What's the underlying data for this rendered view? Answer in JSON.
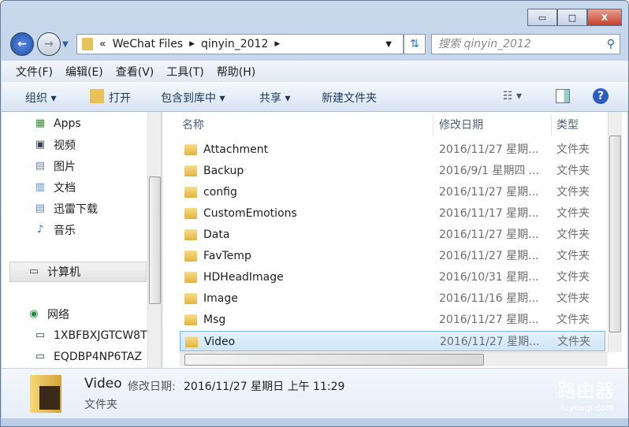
{
  "window": {
    "minimize": "▭",
    "maximize": "□",
    "close": "X"
  },
  "address": {
    "overflow": "«",
    "crumbs": [
      "WeChat Files",
      "qinyin_2012"
    ],
    "search_placeholder": "搜索 qinyin_2012"
  },
  "menu": [
    "文件(F)",
    "编辑(E)",
    "查看(V)",
    "工具(T)",
    "帮助(H)"
  ],
  "toolbar": {
    "organize": "组织 ▾",
    "open": "打开",
    "include": "包含到库中 ▾",
    "share": "共享 ▾",
    "new_folder": "新建文件夹"
  },
  "sidebar": {
    "items": [
      "Apps",
      "视频",
      "图片",
      "文档",
      "迅雷下载",
      "音乐"
    ],
    "computer": "计算机",
    "network": "网络",
    "network_items": [
      "1XBFBXJGTCW8T",
      "EQDBP4NP6TAZ"
    ]
  },
  "columns": {
    "name": "名称",
    "date": "修改日期",
    "type": "类型"
  },
  "files": [
    {
      "name": "Attachment",
      "date": "2016/11/27 星期...",
      "type": "文件夹"
    },
    {
      "name": "Backup",
      "date": "2016/9/1 星期四 ...",
      "type": "文件夹"
    },
    {
      "name": "config",
      "date": "2016/11/27 星期...",
      "type": "文件夹"
    },
    {
      "name": "CustomEmotions",
      "date": "2016/11/17 星期...",
      "type": "文件夹"
    },
    {
      "name": "Data",
      "date": "2016/11/27 星期...",
      "type": "文件夹"
    },
    {
      "name": "FavTemp",
      "date": "2016/11/27 星期...",
      "type": "文件夹"
    },
    {
      "name": "HDHeadImage",
      "date": "2016/10/31 星期...",
      "type": "文件夹"
    },
    {
      "name": "Image",
      "date": "2016/11/16 星期...",
      "type": "文件夹"
    },
    {
      "name": "Msg",
      "date": "2016/11/27 星期...",
      "type": "文件夹"
    },
    {
      "name": "Video",
      "date": "2016/11/27 星期...",
      "type": "文件夹"
    }
  ],
  "selected_index": 9,
  "details": {
    "name": "Video",
    "date_label": "修改日期:",
    "date": "2016/11/27 星期日 上午 11:29",
    "type": "文件夹"
  },
  "watermark": {
    "cn": "路由器",
    "en": "luyouqi.com"
  }
}
